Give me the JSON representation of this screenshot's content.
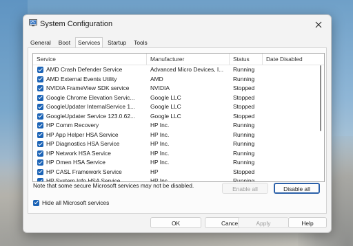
{
  "window": {
    "title": "System Configuration"
  },
  "tabs": [
    {
      "label": "General"
    },
    {
      "label": "Boot"
    },
    {
      "label": "Services",
      "active": true
    },
    {
      "label": "Startup"
    },
    {
      "label": "Tools"
    }
  ],
  "table": {
    "columns": [
      "Service",
      "Manufacturer",
      "Status",
      "Date Disabled"
    ],
    "rows": [
      {
        "service": "AMD Crash Defender Service",
        "manufacturer": "Advanced Micro Devices, I...",
        "status": "Running",
        "checked": true
      },
      {
        "service": "AMD External Events Utility",
        "manufacturer": "AMD",
        "status": "Running",
        "checked": true
      },
      {
        "service": "NVIDIA FrameView SDK service",
        "manufacturer": "NVIDIA",
        "status": "Stopped",
        "checked": true
      },
      {
        "service": "Google Chrome Elevation Servic...",
        "manufacturer": "Google LLC",
        "status": "Stopped",
        "checked": true
      },
      {
        "service": "GoogleUpdater InternalService 1...",
        "manufacturer": "Google LLC",
        "status": "Stopped",
        "checked": true
      },
      {
        "service": "GoogleUpdater Service 123.0.62...",
        "manufacturer": "Google LLC",
        "status": "Stopped",
        "checked": true
      },
      {
        "service": "HP Comm Recovery",
        "manufacturer": "HP Inc.",
        "status": "Running",
        "checked": true
      },
      {
        "service": "HP App Helper HSA Service",
        "manufacturer": "HP Inc.",
        "status": "Running",
        "checked": true
      },
      {
        "service": "HP Diagnostics HSA Service",
        "manufacturer": "HP Inc.",
        "status": "Running",
        "checked": true
      },
      {
        "service": "HP Network HSA Service",
        "manufacturer": "HP Inc.",
        "status": "Running",
        "checked": true
      },
      {
        "service": "HP Omen HSA Service",
        "manufacturer": "HP Inc.",
        "status": "Running",
        "checked": true
      },
      {
        "service": "HP CASL Framework Service",
        "manufacturer": "HP",
        "status": "Stopped",
        "checked": true
      },
      {
        "service": "HP System Info HSA Service",
        "manufacturer": "HP Inc.",
        "status": "Running",
        "checked": true
      }
    ]
  },
  "note": "Note that some secure Microsoft services may not be disabled.",
  "buttons": {
    "enable_all": "Enable all",
    "disable_all": "Disable all",
    "ok": "OK",
    "cancel": "Cancel",
    "apply": "Apply",
    "help": "Help"
  },
  "hide_microsoft": {
    "label": "Hide all Microsoft services",
    "checked": true
  },
  "colors": {
    "accent": "#1b63b6"
  },
  "icons": {
    "app": "msconfig-icon",
    "close": "close-icon",
    "checkbox": "checkbox-checked-icon"
  }
}
